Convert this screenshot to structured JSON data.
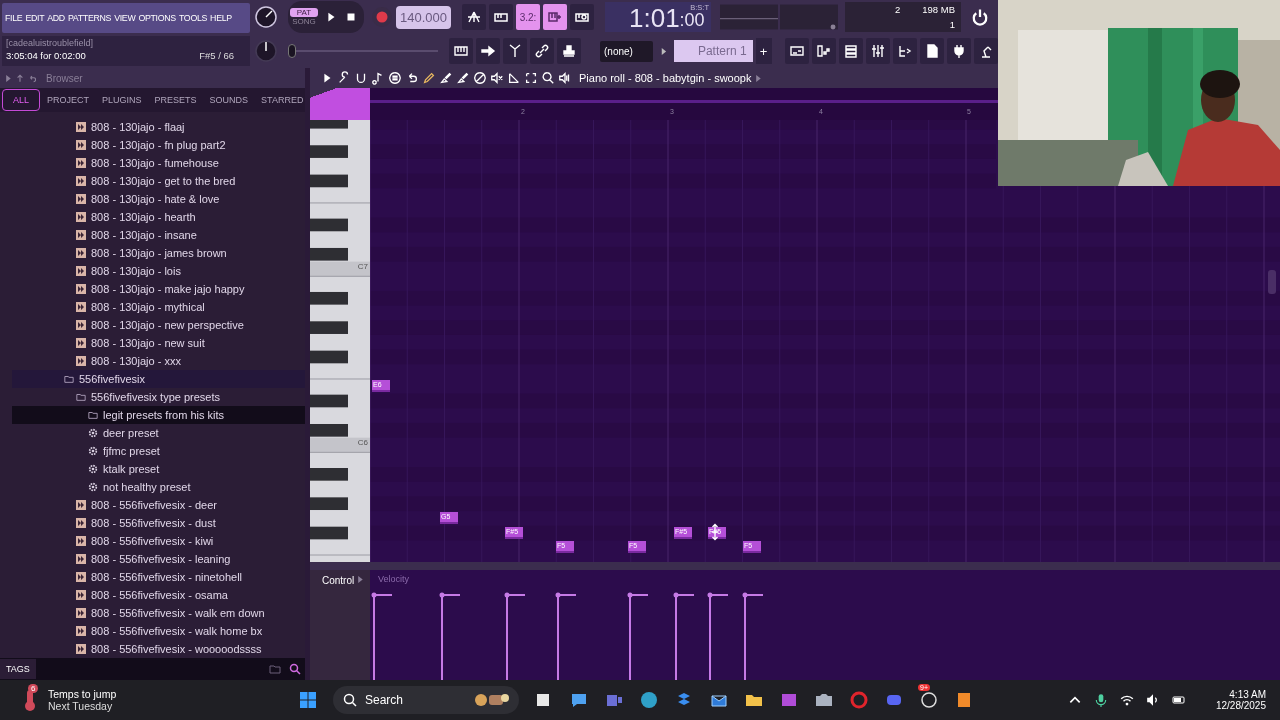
{
  "menu": [
    "FILE",
    "EDIT",
    "ADD",
    "PATTERNS",
    "VIEW",
    "OPTIONS",
    "TOOLS",
    "HELP"
  ],
  "hint": {
    "title": "[cadealuistroublefield]",
    "line": "3:05:04 for 0:02:00",
    "note": "F#5 / 66"
  },
  "transport": {
    "modes": [
      {
        "label": "PAT",
        "selected": true
      },
      {
        "label": "SONG",
        "selected": false
      }
    ],
    "tempo": "140.000",
    "time_main": "1:01",
    "time_ticks": ":00",
    "time_format": "B:S:T",
    "toggles": [
      {
        "kind": "wait",
        "on": false
      },
      {
        "kind": "countdown",
        "on": false
      },
      {
        "kind": "blend",
        "label": "3.2:",
        "on": true
      },
      {
        "kind": "step",
        "on": true
      },
      {
        "kind": "loop",
        "on": false
      }
    ]
  },
  "monitor": {
    "polyphony": "2",
    "memory": "198 MB",
    "count": "1"
  },
  "master_pitch": {
    "level": 0
  },
  "pattern": {
    "preset": "(none)",
    "name": "Pattern 1",
    "add": "+"
  },
  "browser": {
    "title": "Browser",
    "tabs": [
      {
        "label": "ALL",
        "selected": true
      },
      {
        "label": "PROJECT",
        "selected": false
      },
      {
        "label": "PLUGINS",
        "selected": false
      },
      {
        "label": "PRESETS",
        "selected": false
      },
      {
        "label": "SOUNDS",
        "selected": false
      },
      {
        "label": "STARRED",
        "selected": false
      }
    ],
    "continued_items": [
      {
        "label": "808 - 130jajo - flaaj",
        "kind": "preset",
        "selected": false
      },
      {
        "label": "808 - 130jajo - fn plug part2",
        "kind": "preset",
        "selected": false
      },
      {
        "label": "808 - 130jajo - fumehouse",
        "kind": "preset",
        "selected": false
      },
      {
        "label": "808 - 130jajo - get to the bred",
        "kind": "preset",
        "selected": false
      },
      {
        "label": "808 - 130jajo - hate & love",
        "kind": "preset",
        "selected": false
      },
      {
        "label": "808 - 130jajo - hearth",
        "kind": "preset",
        "selected": false
      },
      {
        "label": "808 - 130jajo - insane",
        "kind": "preset",
        "selected": false
      },
      {
        "label": "808 - 130jajo - james brown",
        "kind": "preset",
        "selected": false
      },
      {
        "label": "808 - 130jajo - lois",
        "kind": "preset",
        "selected": false
      },
      {
        "label": "808 - 130jajo - make jajo happy",
        "kind": "preset",
        "selected": false
      },
      {
        "label": "808 - 130jajo - mythical",
        "kind": "preset",
        "selected": false
      },
      {
        "label": "808 - 130jajo - new perspective",
        "kind": "preset",
        "selected": false
      },
      {
        "label": "808 - 130jajo - new suit",
        "kind": "preset",
        "selected": false
      },
      {
        "label": "808 - 130jajo - xxx",
        "kind": "preset",
        "selected": false
      }
    ],
    "folders": [
      {
        "label": "556fivefivesix",
        "kind": "folder",
        "selected": false,
        "children": [
          {
            "label": "556fivefivesix type presets",
            "kind": "folder",
            "selected": false,
            "children": [
              {
                "label": "legit presets from his kits",
                "kind": "folder",
                "selected": true
              },
              {
                "label": "deer preset",
                "kind": "plugin_preset",
                "selected": false
              },
              {
                "label": "fjfmc preset",
                "kind": "plugin_preset",
                "selected": false
              },
              {
                "label": "ktalk preset",
                "kind": "plugin_preset",
                "selected": false
              },
              {
                "label": "not healthy preset",
                "kind": "plugin_preset",
                "selected": false
              }
            ]
          },
          {
            "label": "808 - 556fivefivesix - deer",
            "kind": "preset",
            "selected": false
          },
          {
            "label": "808 - 556fivefivesix - dust",
            "kind": "preset",
            "selected": false
          },
          {
            "label": "808 - 556fivefivesix - kiwi",
            "kind": "preset",
            "selected": false
          },
          {
            "label": "808 - 556fivefivesix - leaning",
            "kind": "preset",
            "selected": false
          },
          {
            "label": "808 - 556fivefivesix - ninetohell",
            "kind": "preset",
            "selected": false
          },
          {
            "label": "808 - 556fivefivesix - osama",
            "kind": "preset",
            "selected": false
          },
          {
            "label": "808 - 556fivefivesix - walk em down",
            "kind": "preset",
            "selected": false
          },
          {
            "label": "808 - 556fivefivesix - walk home bx",
            "kind": "preset",
            "selected": false
          },
          {
            "label": "808 - 556fivefivesix - wooooodssss",
            "kind": "preset",
            "selected": false
          }
        ]
      }
    ],
    "tags": "TAGS"
  },
  "piano_roll": {
    "title": "Piano roll - 808 - babytgin - swoopk",
    "bars": [
      "2",
      "3",
      "4",
      "5"
    ],
    "key_labels": [
      "C7",
      "C6"
    ],
    "notes": [
      {
        "label": "E6"
      },
      {
        "label": "G5"
      },
      {
        "label": "F#5"
      },
      {
        "label": "F5"
      },
      {
        "label": "F5"
      },
      {
        "label": "F#5"
      },
      {
        "label": "F#5"
      },
      {
        "label": "F5"
      }
    ],
    "control": "Control",
    "control_target": "Velocity"
  },
  "taskbar": {
    "weather": {
      "badge": "6",
      "title": "Temps to jump",
      "subtitle": "Next Tuesday"
    },
    "search": {
      "placeholder": "Search"
    },
    "chat_badge": "9+",
    "time": "4:13 AM",
    "date": "12/28/2025"
  }
}
